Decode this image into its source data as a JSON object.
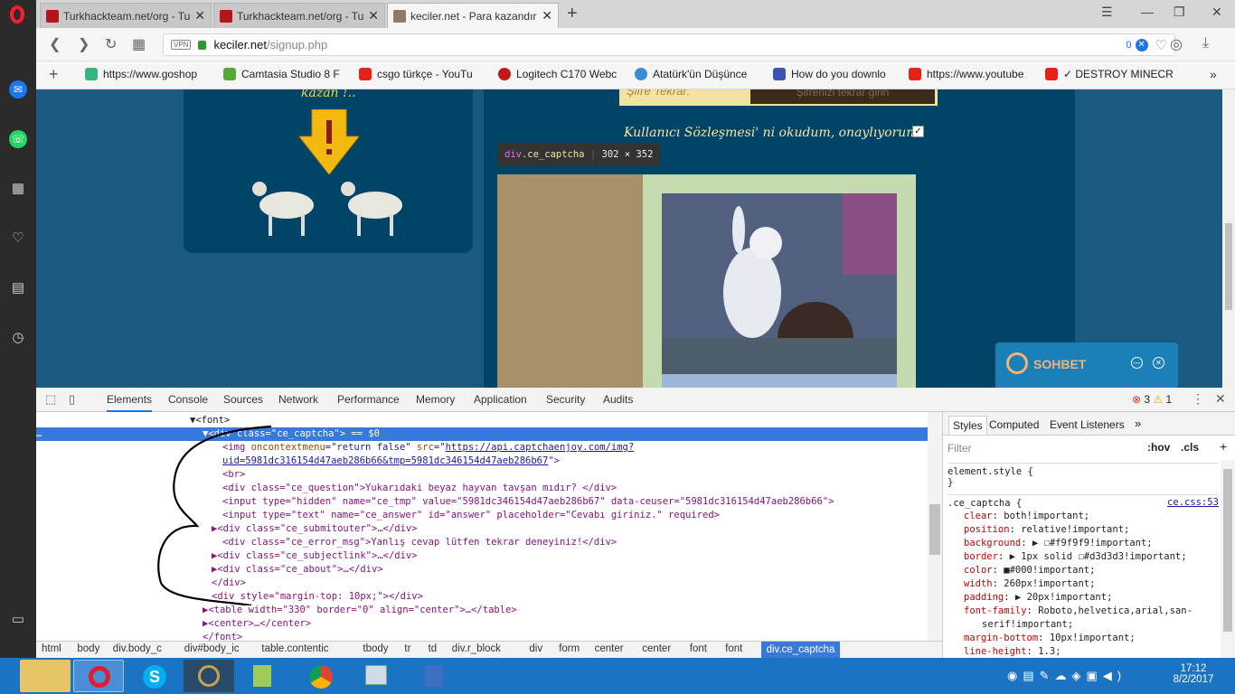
{
  "browser": {
    "tabs": [
      {
        "title": "Turkhackteam.net/org - Tu",
        "active": false,
        "color": "#b3151b"
      },
      {
        "title": "Turkhackteam.net/org - Tu",
        "active": false,
        "color": "#b3151b"
      },
      {
        "title": "keciler.net - Para kazandır",
        "active": true,
        "color": "#777"
      }
    ],
    "url_host": "keciler.net",
    "url_path": "/signup.php",
    "adblock_count": "0",
    "bookmarks": [
      {
        "label": "https://www.goshop",
        "color": "#36b37e"
      },
      {
        "label": "Camtasia Studio 8 F",
        "color": "#57a83a"
      },
      {
        "label": "csgo türkçe - YouTu",
        "color": "#e62117"
      },
      {
        "label": "Logitech C170 Webc",
        "color": "#c01818"
      },
      {
        "label": "Atatürk'ün Düşünce",
        "color": "#3c8bd9"
      },
      {
        "label": "How do you downlo",
        "color": "#3f51b5"
      },
      {
        "label": "https://www.youtube",
        "color": "#e62117"
      },
      {
        "label": "✓ DESTROY MINECR",
        "color": "#e62117"
      }
    ],
    "bookmarks_more": "»"
  },
  "page": {
    "banner_text": "kazan !..",
    "password_label": "Şifre Tekrar:",
    "password_placeholder": "Şifrenizi tekrar girin",
    "agreement": "Kullanıcı Sözleşmesi' ni okudum, onaylıyorum:",
    "tooltip_tag": "div",
    "tooltip_cls": ".ce_captcha",
    "tooltip_size": "302 × 352",
    "chat_label": "SOHBET"
  },
  "devtools": {
    "tabs": [
      "Elements",
      "Console",
      "Sources",
      "Network",
      "Performance",
      "Memory",
      "Application",
      "Security",
      "Audits"
    ],
    "errors": "3",
    "warnings": "1",
    "dom": {
      "l0": "▼<font>",
      "l1a": "▼<div ",
      "l1b": "class",
      "l1c": "=\"ce_captcha\"",
      "l1d": "> == $0",
      "l2a": "<img ",
      "l2b": "oncontextmenu",
      "l2c": "=\"return false\" ",
      "l2d": "src",
      "l2e": "=\"",
      "l2f": "https://api.captchaenjoy.com/img?",
      "l3": "uid=5981dc316154d47aeb286b66&tmp=5981dc346154d47aeb286b67",
      "l3b": "\">",
      "l4": "<br>",
      "l5": "<div class=\"ce_question\">Yukarıdaki beyaz hayvan tavşan mıdır? </div>",
      "l6": "<input type=\"hidden\" name=\"ce_tmp\" value=\"5981dc346154d47aeb286b67\" data-ceuser=\"5981dc316154d47aeb286b66\">",
      "l7": "<input type=\"text\" name=\"ce_answer\" id=\"answer\" placeholder=\"Cevabı giriniz.\" required>",
      "l8": "▶<div class=\"ce_submitouter\">…</div>",
      "l9": "<div class=\"ce_error_msg\">Yanlış cevap lütfen tekrar deneyiniz!</div>",
      "l10": "▶<div class=\"ce_subjectlink\">…</div>",
      "l11": "▶<div class=\"ce_about\">…</div>",
      "l12": "</div>",
      "l13": "<div style=\"margin-top: 10px;\"></div>",
      "l14": "▶<table width=\"330\" border=\"0\" align=\"center\">…</table>",
      "l15": "▶<center>…</center>",
      "l16": "</font>",
      "ellipsis": "…"
    },
    "styles_tabs": [
      "Styles",
      "Computed",
      "Event Listeners"
    ],
    "filter_placeholder": "Filter",
    "hov": ":hov",
    "cls": ".cls",
    "element_style": "element.style {",
    "close_brace": "}",
    "rule_selector": ".ce_captcha {",
    "rule_source": "ce.css:53",
    "props": [
      {
        "n": "clear",
        "v": "both!important;"
      },
      {
        "n": "position",
        "v": "relative!important;"
      },
      {
        "n": "background",
        "v": "▶ ☐#f9f9f9!important;"
      },
      {
        "n": "border",
        "v": "▶ 1px solid ☐#d3d3d3!important;"
      },
      {
        "n": "color",
        "v": "■#000!important;"
      },
      {
        "n": "width",
        "v": "260px!important;"
      },
      {
        "n": "padding",
        "v": "▶ 20px!important;"
      },
      {
        "n": "font-family",
        "v": "Roboto,helvetica,arial,san-"
      },
      {
        "n": "",
        "v": "serif!important;"
      },
      {
        "n": "margin-bottom",
        "v": "10px!important;"
      },
      {
        "n": "line-height",
        "v": "1.3;"
      }
    ],
    "breadcrumbs": [
      "html",
      "body",
      "div.body_c",
      "div#body_ic",
      "table.contentic",
      "tbody",
      "tr",
      "td",
      "div.r_block",
      "div",
      "form",
      "center",
      "center",
      "font",
      "font",
      "div.ce_captcha"
    ]
  },
  "taskbar": {
    "time": "17:12",
    "date": "8/2/2017"
  }
}
